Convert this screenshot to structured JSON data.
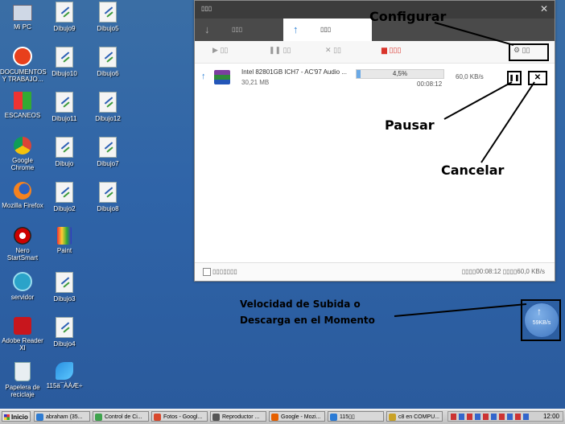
{
  "desktop": {
    "icons": [
      {
        "label": "Mi PC",
        "icon": "computer-icon"
      },
      {
        "label": "DOCUMENTOS Y TRABAJO...",
        "icon": "red-app-icon"
      },
      {
        "label": "ESCANEOS",
        "icon": "puzzle-icon"
      },
      {
        "label": "Google Chrome",
        "icon": "chrome-icon"
      },
      {
        "label": "Mozilla Firefox",
        "icon": "firefox-icon"
      },
      {
        "label": "Nero StartSmart",
        "icon": "nero-icon"
      },
      {
        "label": "servidor",
        "icon": "network-drive-icon"
      },
      {
        "label": "Adobe Reader XI",
        "icon": "pdf-icon"
      },
      {
        "label": "Papelera de reciclaje",
        "icon": "recycle-bin-icon"
      },
      {
        "label": "Dibujo9",
        "icon": "drawing-file-icon"
      },
      {
        "label": "Dibujo10",
        "icon": "drawing-file-icon"
      },
      {
        "label": "Dibujo11",
        "icon": "drawing-file-icon"
      },
      {
        "label": "Dibujo",
        "icon": "drawing-file-icon"
      },
      {
        "label": "Dibujo2",
        "icon": "drawing-file-icon"
      },
      {
        "label": "Paint",
        "icon": "paint-icon"
      },
      {
        "label": "Dibujo3",
        "icon": "drawing-file-icon"
      },
      {
        "label": "Dibujo4",
        "icon": "drawing-file-icon"
      },
      {
        "label": "115ä¯ÀÀÆ÷",
        "icon": "browser-icon"
      },
      {
        "label": "Dibujo5",
        "icon": "drawing-file-icon"
      },
      {
        "label": "Dibujo6",
        "icon": "drawing-file-icon"
      },
      {
        "label": "Dibujo12",
        "icon": "drawing-file-icon"
      },
      {
        "label": "Dibujo7",
        "icon": "drawing-file-icon"
      },
      {
        "label": "Dibujo8",
        "icon": "drawing-file-icon"
      }
    ]
  },
  "app": {
    "title_glyph": "▯▯▯",
    "close_glyph": "✕",
    "tabs": [
      {
        "label": "▯▯▯",
        "icon": "download-arrow-icon"
      },
      {
        "label": "▯▯▯",
        "icon": "upload-arrow-icon"
      }
    ],
    "toolbar": {
      "start_label": "▯▯",
      "pause_label": "▯▯",
      "delete_label": "▯▯",
      "clear_label": "▯▯▯",
      "settings_label": "▯▯"
    },
    "transfer": {
      "filename": "Intel 82801GB ICH7 - AC'97 Audio ...",
      "size": "30,21 MB",
      "progress": "4,5%",
      "progress_fraction": 0.045,
      "elapsed": "00:08:12",
      "speed": "60,0 KB/s"
    },
    "status": {
      "left_label": "▯▯▯▯▯▯▯",
      "right_text": "▯▯▯▯00:08:12 ▯▯▯▯60,0 KB/s"
    }
  },
  "floating_ball": {
    "speed": "59KB/s"
  },
  "annotations": {
    "configurar": "Configurar",
    "pausar": "Pausar",
    "cancelar": "Cancelar",
    "velocidad": "Velocidad de Subida o Descarga en el Momento"
  },
  "taskbar": {
    "start_label": "Inicio",
    "tasks": [
      {
        "label": "abraham (35...",
        "color": "#2e7bd1"
      },
      {
        "label": "Control de Ci...",
        "color": "#3fa34d"
      },
      {
        "label": "Fotos - Googl...",
        "color": "#d8482c"
      },
      {
        "label": "Reproductor ...",
        "color": "#555555"
      },
      {
        "label": "Google - Mozi...",
        "color": "#e66000"
      },
      {
        "label": "115▯▯",
        "color": "#2b7bd6"
      },
      {
        "label": "c8 en COMPU...",
        "color": "#c9a227"
      }
    ],
    "clock": "12:00"
  }
}
